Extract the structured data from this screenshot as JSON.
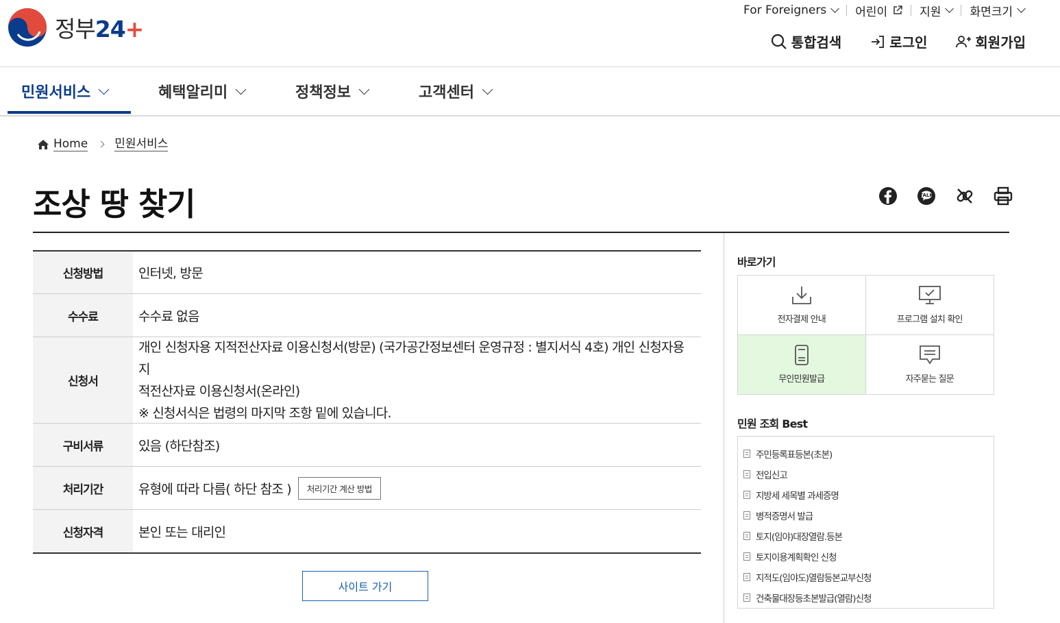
{
  "header": {
    "logo": {
      "text_main": "정부",
      "text_num": "24",
      "text_plus": "+"
    },
    "utility": [
      {
        "label": "For Foreigners",
        "icon": "chevron-down-icon"
      },
      {
        "label": "어린이",
        "icon": "external-link-icon"
      },
      {
        "label": "지원",
        "icon": "chevron-down-icon"
      },
      {
        "label": "화면크기",
        "icon": "chevron-down-icon"
      }
    ],
    "member": {
      "search": "통합검색",
      "login": "로그인",
      "signup": "회원가입"
    }
  },
  "gnb": {
    "items": [
      "민원서비스",
      "혜택알리미",
      "정책정보",
      "고객센터"
    ],
    "active_index": 0
  },
  "breadcrumb": {
    "home": "Home",
    "current": "민원서비스"
  },
  "page": {
    "title": "조상 땅 찾기"
  },
  "share_icons": [
    "facebook-icon",
    "kakao-icon",
    "link-icon",
    "print-icon"
  ],
  "info_table": {
    "rows": [
      {
        "th": "신청방법",
        "td": "인터넷, 방문"
      },
      {
        "th": "수수료",
        "td": "수수료 없음"
      },
      {
        "th": "신청서",
        "td_line1": "개인 신청자용 지적전산자료 이용신청서(방문) (국가공간정보센터 운영규정 : 별지서식 4호) 개인 신청자용 지",
        "td_line2": "적전산자료 이용신청서(온라인)",
        "td_line3": "※ 신청서식은 법령의 마지막 조항 밑에 있습니다."
      },
      {
        "th": "구비서류",
        "td": "있음 (하단참조)"
      },
      {
        "th": "처리기간",
        "td": "유형에 따라 다름( 하단 참조 )",
        "button": "처리기간 계산 방법"
      },
      {
        "th": "신청자격",
        "td": "본인 또는 대리인"
      }
    ]
  },
  "site_button": "사이트 가기",
  "sidebar": {
    "quick_title": "바로가기",
    "quick_links": [
      {
        "label": "전자결제 안내",
        "icon": "download-icon"
      },
      {
        "label": "프로그램 설치 확인",
        "icon": "monitor-check-icon"
      },
      {
        "label": "무인민원발급",
        "icon": "kiosk-icon"
      },
      {
        "label": "자주묻는 질문",
        "icon": "faq-chat-icon"
      }
    ],
    "best_title": "민원 조회 Best",
    "best_items": [
      "주민등록표등본(초본)",
      "전입신고",
      "지방세 세목별 과세증명",
      "병적증명서 발급",
      "토지(임야)대장열람.등본",
      "토지이용계획확인 신청",
      "지적도(임야도)열람등본교부신청",
      "건축물대장등초본발급(열람)신청"
    ]
  },
  "colors": {
    "brand_blue": "#0b3b8c",
    "link_blue": "#1761b0",
    "highlight_green": "#e3f8df",
    "logo_red": "#e24b3c"
  }
}
